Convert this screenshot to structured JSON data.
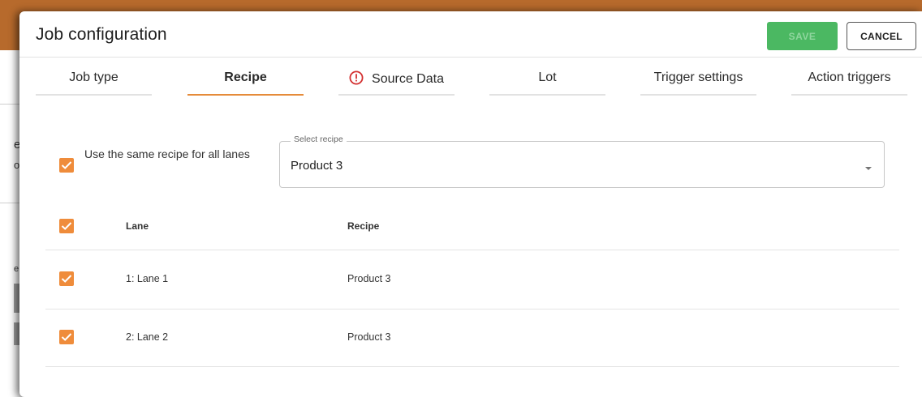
{
  "colors": {
    "accent": "#e58b3a",
    "checkbox": "#ef8c3b",
    "save_bg": "#4bb862",
    "warning": "#d32f2f"
  },
  "background": {
    "fragments": [
      "e",
      "o",
      "e"
    ]
  },
  "dialog": {
    "title": "Job configuration",
    "save_label": "SAVE",
    "cancel_label": "CANCEL"
  },
  "tabs": [
    {
      "label": "Job type",
      "active": false
    },
    {
      "label": "Recipe",
      "active": true
    },
    {
      "label": "Source Data",
      "active": false,
      "icon": "warning-circle-icon"
    },
    {
      "label": "Lot",
      "active": false
    },
    {
      "label": "Trigger settings",
      "active": false
    },
    {
      "label": "Action triggers",
      "active": false
    }
  ],
  "recipe": {
    "same_recipe_label": "Use the same recipe for all lanes",
    "same_recipe_checked": true,
    "select_label": "Select recipe",
    "select_value": "Product 3"
  },
  "table": {
    "header_checked": true,
    "columns": [
      "Lane",
      "Recipe"
    ],
    "rows": [
      {
        "checked": true,
        "lane": "1: Lane 1",
        "recipe": "Product 3"
      },
      {
        "checked": true,
        "lane": "2: Lane 2",
        "recipe": "Product 3"
      }
    ]
  }
}
